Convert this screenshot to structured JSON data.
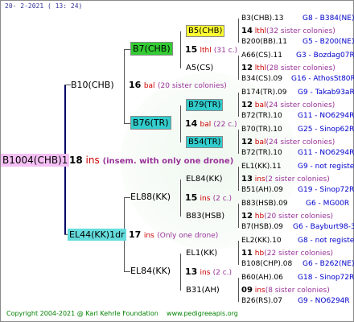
{
  "header": {
    "date": "20-  2-2021 ( 13: 24)"
  },
  "footer": {
    "copyright": "Copyright 2004-2021 @ Karl Kehrle Foundation",
    "site": "www.pedigreeapis.org"
  },
  "root": {
    "label": "B1004(CHB)1",
    "gen": "18",
    "suffix": "ins",
    "note": "(insem. with only one drone)"
  },
  "queen_line": {
    "label": "B10(CHB)",
    "gen": "16",
    "suffix": "bal",
    "note": "(20 sister colonies)"
  },
  "drone_line": {
    "label": "EL44(KK)1dr",
    "gen": "17",
    "suffix": "ins",
    "note": "(Only one drone)"
  },
  "q_mother": {
    "label": "B7(CHB)",
    "gen": "15",
    "suffix": "lthl",
    "note": "(31 c.)"
  },
  "q_father": {
    "label": "B76(TR)",
    "gen": "14",
    "suffix": "bal",
    "note": "(22 c.)"
  },
  "d_mother": {
    "label": "EL88(KK)",
    "gen": "15",
    "suffix": "ins",
    "note": "(2 c.)"
  },
  "d_father": {
    "label": "EL84(KK)",
    "gen": "13",
    "suffix": "ins",
    "note": "(2 c.)"
  },
  "gen3": [
    {
      "label": "B5(CHB)"
    },
    {
      "label": "A5(CS)"
    },
    {
      "label": "B79(TR)"
    },
    {
      "label": "B54(TR)"
    },
    {
      "label": "EL84(KK)"
    },
    {
      "label": "B83(HSB)"
    },
    {
      "label": "EL1(KK)"
    },
    {
      "label": "B31(AH)"
    }
  ],
  "gen4": [
    {
      "a": "B3(CHB).13",
      "b": "G8 - B384(NE)",
      "gen": "14",
      "suf": "lthl",
      "note": "(32 sister colonies)",
      "c": "B200(BB).11",
      "d": "G5 - B200(NE)"
    },
    {
      "a": "A66(CS).11",
      "b": "G3 - Bozdag07R",
      "gen": "12",
      "suf": "lthl",
      "note": "(28 sister colonies)",
      "c": "B34(CS).09",
      "d": "G16 - AthosSt80R"
    },
    {
      "a": "B174(TR).09",
      "b": "G9 - Takab93aR",
      "gen": "12",
      "suf": "bal",
      "note": "(24 sister colonies)",
      "c": "B72(TR).10",
      "d": "G11 - NO6294R"
    },
    {
      "a": "B70(TR).10",
      "b": "G25 - Sinop62R",
      "gen": "12",
      "suf": "bal",
      "note": "(24 sister colonies)",
      "c": "B72(TR).10",
      "d": "G11 - NO6294R"
    },
    {
      "a": "EL1(KK).11",
      "b": "G9 - not registe",
      "gen": "13",
      "suf": "ins",
      "note": "(2 sister colonies)",
      "c": "B51(AH).09",
      "d": "G19 - Sinop72R"
    },
    {
      "a": "B83(HSB).09",
      "b": "G6 - MG00R",
      "gen": "12",
      "suf": "hb",
      "note": "(20 sister colonies)",
      "c": "B7(HSB).09",
      "d": "G6 - Bayburt98-3"
    },
    {
      "a": "EL2(KK).10",
      "b": "G8 - not registe",
      "gen": "11",
      "suf": "hb",
      "note": "(22 sister colonies)",
      "c": "B108(CHP).08",
      "d": "G6 - B262(NE)"
    },
    {
      "a": "B60(AH).06",
      "b": "G18 - Sinop72R",
      "gen": "09",
      "suf": "ins",
      "note": "(8 sister colonies)",
      "c": "B26(RS).07",
      "d": "G9 - NO6294R"
    }
  ]
}
